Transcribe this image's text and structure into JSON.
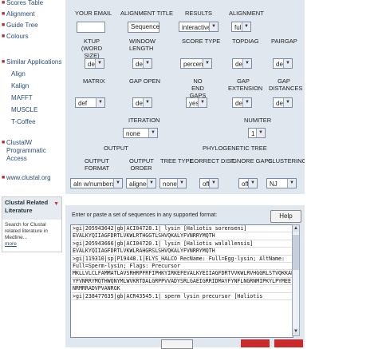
{
  "sidebar": {
    "items": [
      {
        "label": "Scores Table"
      },
      {
        "label": "Alignment"
      },
      {
        "label": "Guide Tree"
      },
      {
        "label": "Colours"
      }
    ],
    "similar_apps_label": "Similar Applications",
    "similar_apps": [
      "Align",
      "Kalign",
      "MAFFT",
      "MUSCLE",
      "T-Coffee"
    ],
    "clustalw_label": "ClustalW Programmatic Access",
    "website_label": "www.clustal.org",
    "related": {
      "title": "Clustal Related Literature",
      "body": "Search for Clustal related literature in Medline...",
      "more": "more"
    }
  },
  "params": {
    "row1": {
      "email": {
        "label": "YOUR EMAIL",
        "value": ""
      },
      "title": {
        "label": "ALIGNMENT TITLE",
        "value": "Sequence"
      },
      "results": {
        "label": "RESULTS",
        "value": "interactive"
      },
      "alignment": {
        "label": "ALIGNMENT",
        "value": "full"
      }
    },
    "row2": {
      "ktup": {
        "label": "KTUP (WORD SIZE)",
        "value": "def"
      },
      "window": {
        "label": "WINDOW LENGTH",
        "value": "def"
      },
      "score": {
        "label": "SCORE TYPE",
        "value": "percent"
      },
      "topdiag": {
        "label": "TOPDIAG",
        "value": "def"
      },
      "pairgap": {
        "label": "PAIRGAP",
        "value": "def"
      }
    },
    "row3": {
      "matrix": {
        "label": "MATRIX",
        "value": "def"
      },
      "gapopen": {
        "label": "GAP OPEN",
        "value": "def"
      },
      "noend": {
        "label": "NO END GAPS",
        "value": "yes"
      },
      "gapext": {
        "label": "GAP EXTENSION",
        "value": "def"
      },
      "gapdist": {
        "label": "GAP DISTANCES",
        "value": "def"
      }
    },
    "row4": {
      "iteration": {
        "label": "ITERATION",
        "value": "none"
      },
      "numiter": {
        "label": "NUMITER",
        "value": "1"
      }
    },
    "row5": {
      "output_header": "OUTPUT",
      "tree_header": "PHYLOGENETIC TREE",
      "format": {
        "label": "OUTPUT FORMAT",
        "value": "aln w/numbers"
      },
      "order": {
        "label": "OUTPUT ORDER",
        "value": "aligned"
      },
      "treetype": {
        "label": "TREE TYPE",
        "value": "none"
      },
      "correct": {
        "label": "CORRECT DIST.",
        "value": "off"
      },
      "ignoregaps": {
        "label": "IGNORE GAPS",
        "value": "off"
      },
      "clustering": {
        "label": "CLUSTERING",
        "value": "NJ"
      }
    }
  },
  "sequence": {
    "prompt": "Enter or paste a set of sequences in any supported format:",
    "help_label": "Help",
    "lines": [
      ">gi|205943642|gb|ACI04728.1| lysin [Haliotis sorenseni]",
      "EVALKYQIIAGFDRTLVKWLRTHGGTLSHVQKALYFVNRRYMQTH",
      ">gi|205943666|gb|ACI04720.1| lysin [Haliotis walallensis]",
      "EVALKYQIIAGFDRTLVKWLRAHGRSLSHVQKALYFVNRRYMQTH",
      ">gi|119310|sp|P19448.1|ELYS_HALCO RecName: Full=Egg-lysin; AltName:",
      "Full=Sperm-lysin; Flags: Precursor",
      "MKLLVLCLFAMMATLAVSRHRPFRFIPHKYIRKEFEVALKYEIIAGFDRTVVKWLRVHGGRLSTVQKKAL",
      "YFVNRRYMQTHWQNYMLWVKRTDALGRPPVVADYSRLGAEIGRRIDMAYFYNFLNGRNMIPKYLPYMEE",
      "NRMRRADVPVANRGK",
      ">gi|238477635|gb|ACR43545.1| sperm lysin precursor [Haliotis"
    ]
  }
}
